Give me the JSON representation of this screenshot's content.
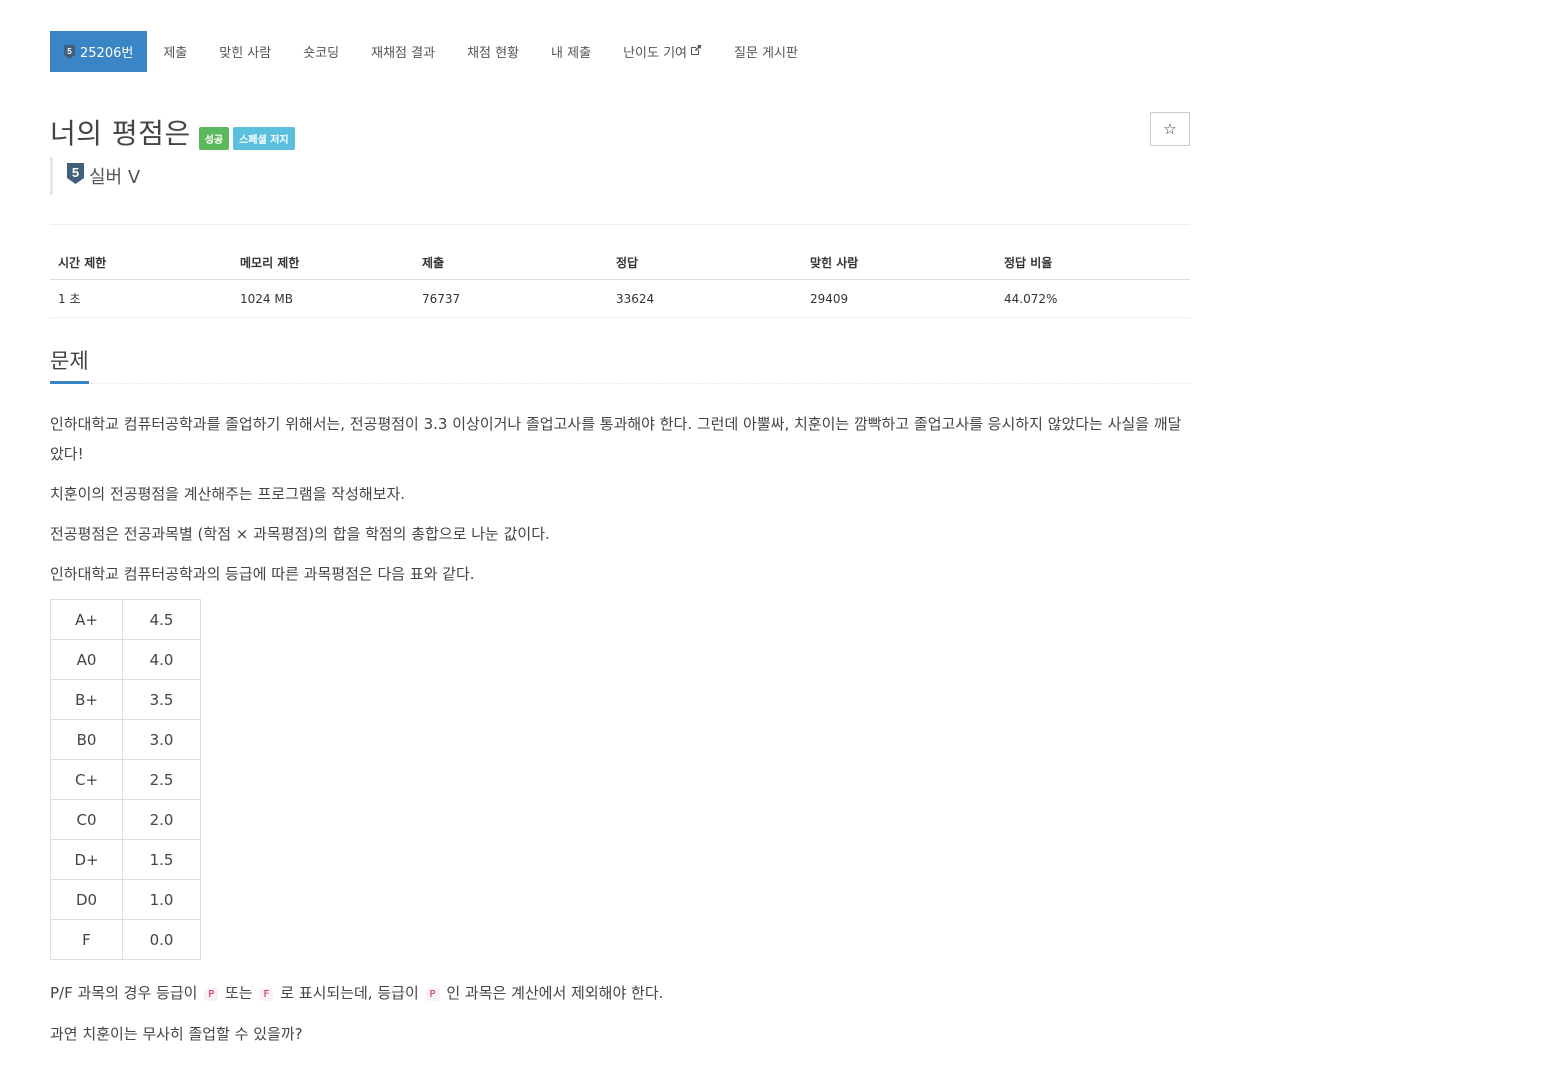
{
  "nav": {
    "problem_id_label": "25206번",
    "tier_badge_number": "5",
    "items": [
      {
        "label": "제출"
      },
      {
        "label": "맞힌 사람"
      },
      {
        "label": "숏코딩"
      },
      {
        "label": "재채점 결과"
      },
      {
        "label": "채점 현황"
      },
      {
        "label": "내 제출"
      },
      {
        "label": "난이도 기여"
      },
      {
        "label": "질문 게시판"
      }
    ],
    "external_icon": "external-link-icon"
  },
  "problem": {
    "title": "너의 평점은",
    "labels": [
      "성공",
      "스페셜 저지"
    ],
    "tier": {
      "number": "5",
      "name": "실버 V"
    },
    "star_icon": "☆"
  },
  "info_table": {
    "headers": [
      "시간 제한",
      "메모리 제한",
      "제출",
      "정답",
      "맞힌 사람",
      "정답 비율"
    ],
    "values": [
      "1 초",
      "1024 MB",
      "76737",
      "33624",
      "29409",
      "44.072%"
    ]
  },
  "section": {
    "heading": "문제",
    "p1": "인하대학교 컴퓨터공학과를 졸업하기 위해서는, 전공평점이 3.3 이상이거나 졸업고사를 통과해야 한다. 그런데 아뿔싸, 치훈이는 깜빡하고 졸업고사를 응시하지 않았다는 사실을 깨달았다!",
    "p2": "치훈이의 전공평점을 계산해주는 프로그램을 작성해보자.",
    "p3": "전공평점은 전공과목별 (학점 × 과목평점)의 합을 학점의 총합으로 나눈 값이다.",
    "p4": "인하대학교 컴퓨터공학과의 등급에 따른 과목평점은 다음 표와 같다.",
    "grades": [
      {
        "grade": "A+",
        "value": "4.5"
      },
      {
        "grade": "A0",
        "value": "4.0"
      },
      {
        "grade": "B+",
        "value": "3.5"
      },
      {
        "grade": "B0",
        "value": "3.0"
      },
      {
        "grade": "C+",
        "value": "2.5"
      },
      {
        "grade": "C0",
        "value": "2.0"
      },
      {
        "grade": "D+",
        "value": "1.5"
      },
      {
        "grade": "D0",
        "value": "1.0"
      },
      {
        "grade": "F",
        "value": "0.0"
      }
    ],
    "p5_a": "P/F 과목의 경우 등급이",
    "p5_code1": "P",
    "p5_b": "또는",
    "p5_code2": "F",
    "p5_c": "로 표시되는데, 등급이",
    "p5_code3": "P",
    "p5_d": "인 과목은 계산에서 제외해야 한다.",
    "p6": "과연 치훈이는 무사히 졸업할 수 있을까?"
  },
  "colors": {
    "accent": "#3a85c6",
    "success_label": "#5cb85c",
    "info_label": "#5bc0de",
    "silver_tier": "#435f7a"
  }
}
